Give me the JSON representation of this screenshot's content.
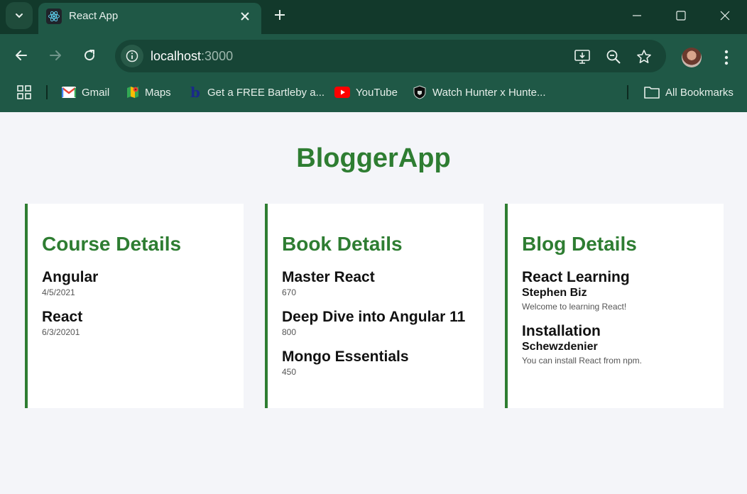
{
  "browser": {
    "tab_title": "React App",
    "url_host": "localhost",
    "url_port": ":3000",
    "bookmarks": [
      {
        "label": "Gmail",
        "icon": "gmail-icon"
      },
      {
        "label": "Maps",
        "icon": "maps-icon"
      },
      {
        "label": "Get a FREE Bartleby a...",
        "icon": "bartleby-icon"
      },
      {
        "label": "YouTube",
        "icon": "youtube-icon"
      },
      {
        "label": "Watch Hunter x Hunte...",
        "icon": "shield-icon"
      }
    ],
    "all_bookmarks": "All Bookmarks",
    "colors": {
      "frame": "#12392b",
      "toolbar": "#1f5846",
      "omnibox": "#174536"
    }
  },
  "page": {
    "title": "BloggerApp",
    "accent": "#2e7d32",
    "courses": {
      "heading": "Course Details",
      "items": [
        {
          "name": "Angular",
          "date": "4/5/2021"
        },
        {
          "name": "React",
          "date": "6/3/20201"
        }
      ]
    },
    "books": {
      "heading": "Book Details",
      "items": [
        {
          "name": "Master React",
          "price": "670"
        },
        {
          "name": "Deep Dive into Angular 11",
          "price": "800"
        },
        {
          "name": "Mongo Essentials",
          "price": "450"
        }
      ]
    },
    "blogs": {
      "heading": "Blog Details",
      "items": [
        {
          "title": "React Learning",
          "author": "Stephen Biz",
          "content": "Welcome to learning React!"
        },
        {
          "title": "Installation",
          "author": "Schewzdenier",
          "content": "You can install React from npm."
        }
      ]
    }
  }
}
